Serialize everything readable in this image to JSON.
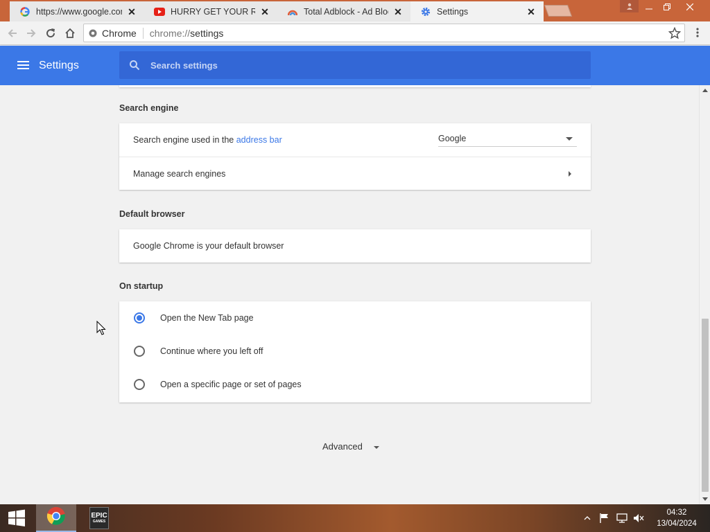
{
  "tabs": [
    {
      "title": "https://www.google.com",
      "favicon": "google-g-icon",
      "active": false
    },
    {
      "title": "HURRY GET YOUR ROBUX",
      "favicon": "youtube-icon",
      "active": false
    },
    {
      "title": "Total Adblock - Ad Blocker",
      "favicon": "adblock-icon",
      "active": false
    },
    {
      "title": "Settings",
      "favicon": "gear-icon",
      "active": true
    }
  ],
  "omnibox": {
    "scheme_label": "Chrome",
    "url_prefix": "chrome://",
    "url_path": "settings"
  },
  "header": {
    "title": "Settings",
    "search_placeholder": "Search settings"
  },
  "search_engine": {
    "section_title": "Search engine",
    "used_in_prefix": "Search engine used in the ",
    "used_in_link": "address bar",
    "selected_engine": "Google",
    "manage_label": "Manage search engines"
  },
  "default_browser": {
    "section_title": "Default browser",
    "status": "Google Chrome is your default browser"
  },
  "on_startup": {
    "section_title": "On startup",
    "options": [
      {
        "label": "Open the New Tab page",
        "checked": true
      },
      {
        "label": "Continue where you left off",
        "checked": false
      },
      {
        "label": "Open a specific page or set of pages",
        "checked": false
      }
    ]
  },
  "advanced_label": "Advanced",
  "taskbar": {
    "apps": [
      "chrome-icon",
      "epic-games-icon"
    ],
    "epic_label_top": "EPIC",
    "epic_label_bottom": "GAMES",
    "time": "04:32",
    "date": "13/04/2024"
  },
  "colors": {
    "accent": "#3b78e7",
    "search_bg": "#3367d6",
    "titlebar": "#c8653a"
  }
}
